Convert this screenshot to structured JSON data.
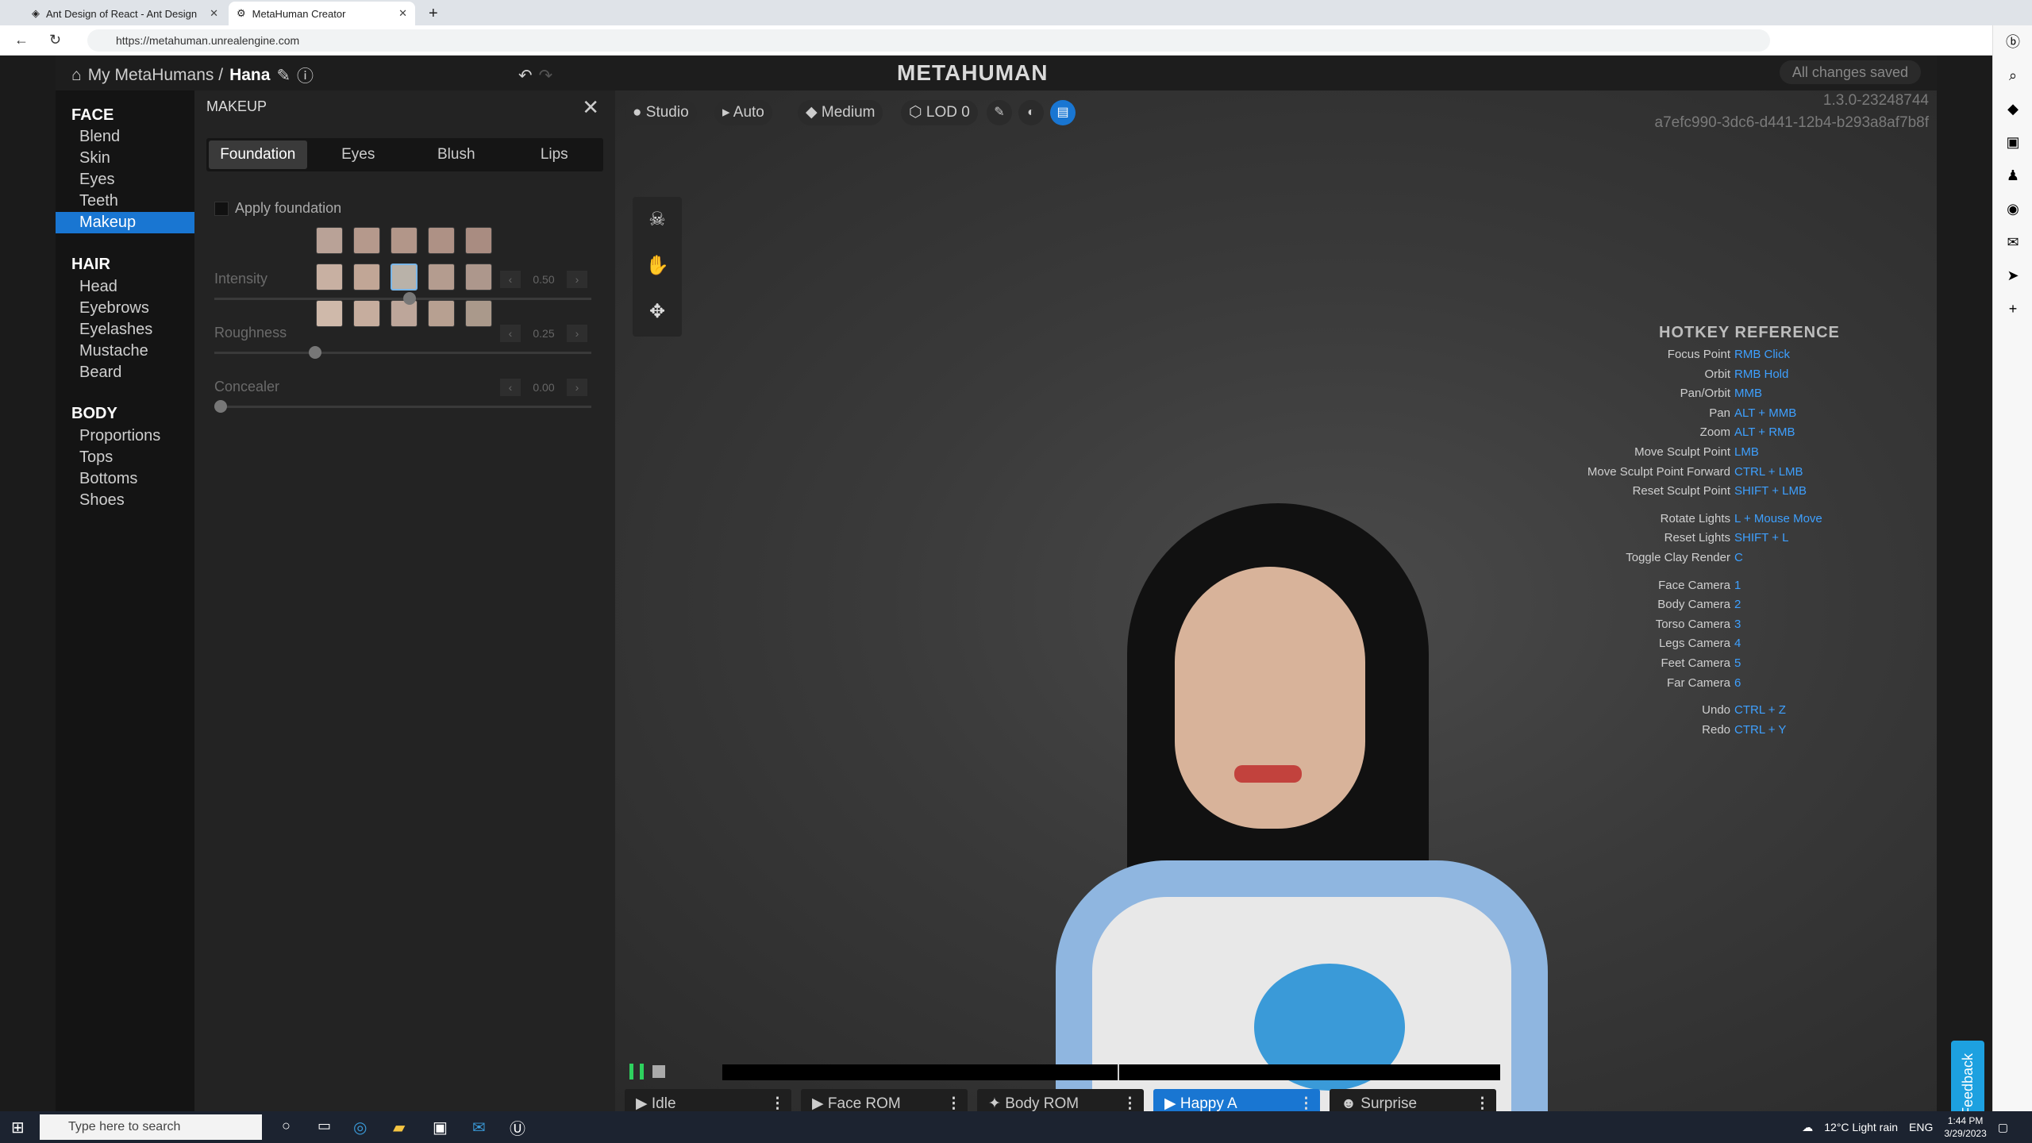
{
  "browser": {
    "tabs": [
      {
        "title": "Ant Design of React - Ant Design"
      },
      {
        "title": "MetaHuman Creator"
      }
    ],
    "url": "https://metahuman.unrealengine.com"
  },
  "header": {
    "breadcrumb_root": "My MetaHumans /",
    "character": "Hana",
    "logo": "METAHUMAN",
    "saved": "All changes saved"
  },
  "nav": {
    "face": "FACE",
    "face_items": [
      "Blend",
      "Skin",
      "Eyes",
      "Teeth",
      "Makeup"
    ],
    "hair": "HAIR",
    "hair_items": [
      "Head",
      "Eyebrows",
      "Eyelashes",
      "Mustache",
      "Beard"
    ],
    "body": "BODY",
    "body_items": [
      "Proportions",
      "Tops",
      "Bottoms",
      "Shoes"
    ],
    "selected": "Makeup"
  },
  "panel": {
    "title": "MAKEUP",
    "tabs": [
      "Foundation",
      "Eyes",
      "Blush",
      "Lips"
    ],
    "apply_label": "Apply foundation",
    "swatch_colors": [
      "#b9a297",
      "#b5998c",
      "#b29689",
      "#ae9185",
      "#a98c81",
      "#c8b0a2",
      "#c1a696",
      "#b9b2a9",
      "#b49c8f",
      "#ad978c",
      "#cfb9aa",
      "#c6ad9e",
      "#bda69a",
      "#b7a091",
      "#aa998b"
    ],
    "sliders": [
      {
        "label": "Intensity",
        "value": "0.50",
        "level": 0.5
      },
      {
        "label": "Roughness",
        "value": "0.25",
        "level": 0.25
      },
      {
        "label": "Concealer",
        "value": "0.00",
        "level": 0
      }
    ]
  },
  "viewport": {
    "buttons": [
      "Studio",
      "Auto",
      "Medium",
      "LOD 0"
    ],
    "version": "1.3.0-23248744",
    "id": "a7efc990-3dc6-d441-12b4-b293a8af7b8f"
  },
  "hotkeys": {
    "title": "HOTKEY REFERENCE",
    "rows": [
      [
        "Focus Point",
        "RMB Click"
      ],
      [
        "Orbit",
        "RMB Hold"
      ],
      [
        "Pan/Orbit",
        "MMB"
      ],
      [
        "Pan",
        "ALT + MMB"
      ],
      [
        "Zoom",
        "ALT + RMB"
      ],
      [
        "Move Sculpt Point",
        "LMB"
      ],
      [
        "Move Sculpt Point Forward",
        "CTRL + LMB"
      ],
      [
        "Reset Sculpt Point",
        "SHIFT + LMB"
      ],
      [
        "Rotate Lights",
        "L + Mouse Move"
      ],
      [
        "Reset Lights",
        "SHIFT + L"
      ],
      [
        "Toggle Clay Render",
        "C"
      ],
      [
        "Face Camera",
        "1"
      ],
      [
        "Body Camera",
        "2"
      ],
      [
        "Torso Camera",
        "3"
      ],
      [
        "Legs Camera",
        "4"
      ],
      [
        "Feet Camera",
        "5"
      ],
      [
        "Far Camera",
        "6"
      ],
      [
        "Undo",
        "CTRL + Z"
      ],
      [
        "Redo",
        "CTRL + Y"
      ]
    ]
  },
  "timeline": {
    "animations": [
      "Idle",
      "Face ROM",
      "Body ROM",
      "Happy A",
      "Surprise"
    ],
    "selected": "Happy A"
  },
  "feedback": "Feedback",
  "taskbar": {
    "search": "Type here to search",
    "weather": "12°C  Light rain",
    "lang": "ENG",
    "time": "1:44 PM",
    "date": "3/29/2023"
  }
}
